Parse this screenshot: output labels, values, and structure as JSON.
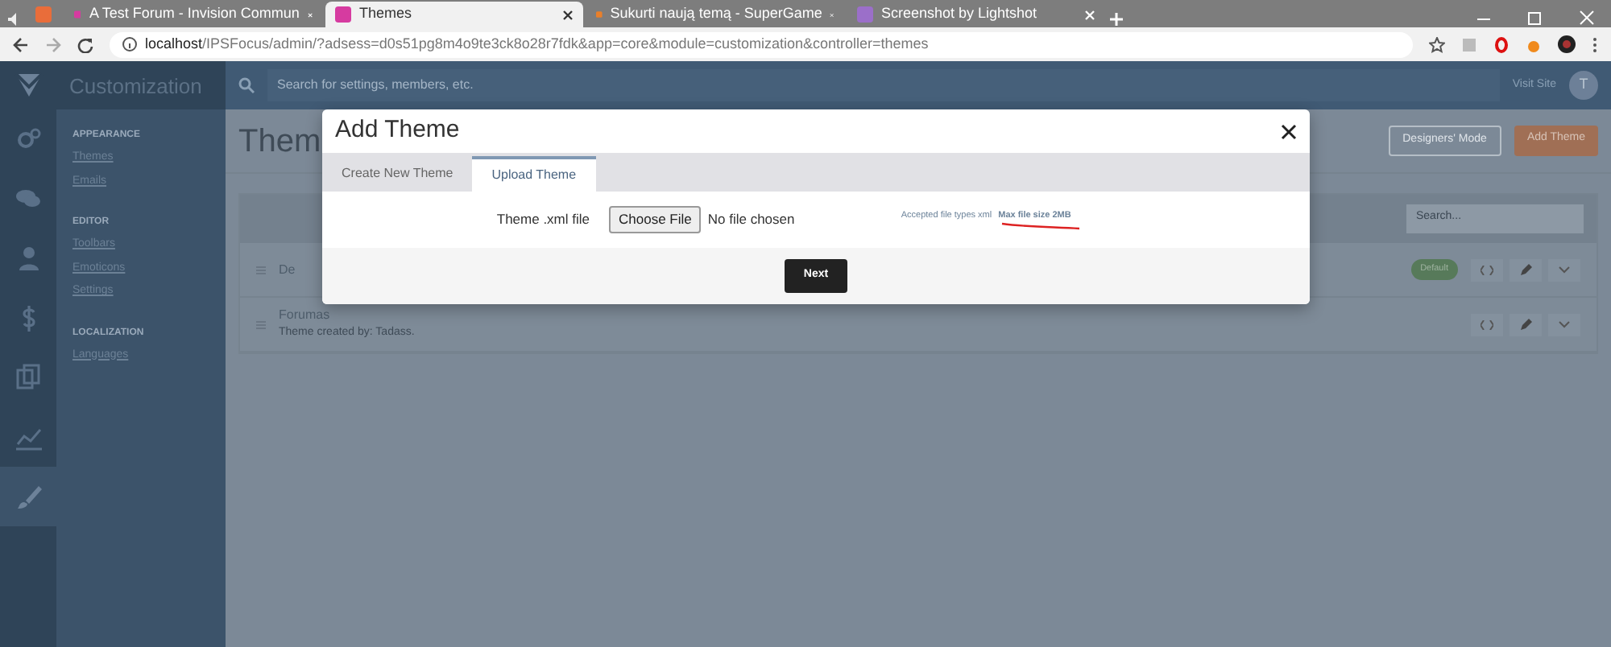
{
  "browser": {
    "tabs": [
      {
        "kind": "pinned",
        "selected": false
      },
      {
        "title": "A Test Forum - Invision Commun",
        "kind": "page",
        "selected": false
      },
      {
        "title": "Themes",
        "kind": "page",
        "selected": true
      },
      {
        "title": "Sukurti naują temą - SuperGame",
        "kind": "page",
        "selected": false
      },
      {
        "title": "Screenshot by Lightshot",
        "kind": "page",
        "selected": false
      }
    ],
    "url_host": "localhost",
    "url_path": "/IPSFocus/admin/?adsess=d0s51pg8m4o9te3ck8o28r7fdk&app=core&module=customization&controller=themes"
  },
  "admin": {
    "section_title": "Customization",
    "search": {
      "placeholder": "Search for settings, members, etc."
    },
    "visit_site": "Visit Site",
    "user_initial": "T",
    "rail": [
      {
        "selected": false
      },
      {
        "selected": false
      },
      {
        "selected": false
      },
      {
        "selected": false
      },
      {
        "selected": false
      },
      {
        "selected": false
      },
      {
        "selected": true
      }
    ],
    "sidebar": [
      {
        "heading": "APPEARANCE",
        "items": [
          "Themes",
          "Emails"
        ]
      },
      {
        "heading": "EDITOR",
        "items": [
          "Toolbars",
          "Emoticons",
          "Settings"
        ]
      },
      {
        "heading": "LOCALIZATION",
        "items": [
          "Languages"
        ]
      }
    ],
    "page_title": "Them",
    "buttons": [
      {
        "label": "Designers' Mode",
        "kind": "outline"
      },
      {
        "label": "Add Theme",
        "kind": "primary"
      }
    ],
    "table_search": {
      "placeholder": "Search..."
    },
    "rows": [
      {
        "title": "De",
        "badge": "Default"
      },
      {
        "title": "Forumas",
        "subtitle": "Theme created by: Tadass."
      }
    ]
  },
  "modal": {
    "title": "Add Theme",
    "tabs": [
      {
        "label": "Create New Theme",
        "selected": false
      },
      {
        "label": "Upload Theme",
        "selected": true
      }
    ],
    "field_label": "Theme .xml file",
    "file_button": "Choose File",
    "file_status": "No file chosen",
    "accepted": "Accepted file types xml",
    "max_size": "Max file size 2MB",
    "submit": "Next"
  }
}
